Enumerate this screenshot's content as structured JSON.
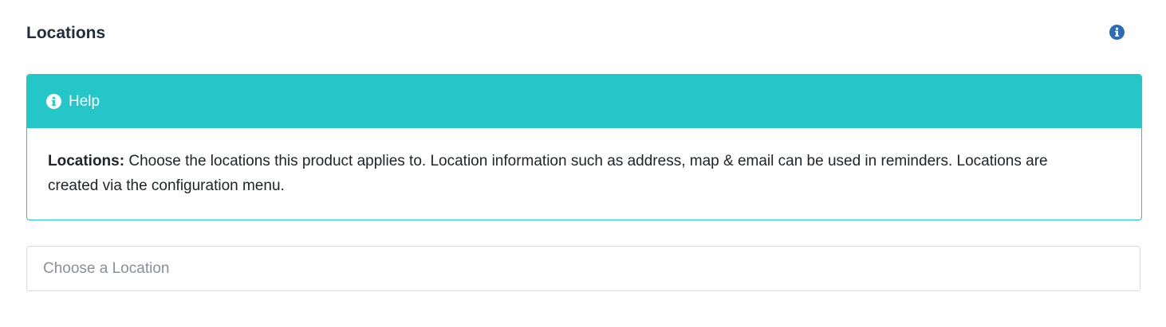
{
  "section": {
    "title": "Locations",
    "info_icon": "info-circle-icon"
  },
  "help": {
    "header_label": "Help",
    "header_icon": "info-circle-icon",
    "lead": "Locations:",
    "text": " Choose the locations this product applies to. Location information such as address, map & email can be used in reminders. Locations are created via the configuration menu."
  },
  "location_select": {
    "placeholder": "Choose a Location"
  },
  "colors": {
    "accent_teal": "#24c6c8",
    "info_blue": "#2d6bb8"
  }
}
